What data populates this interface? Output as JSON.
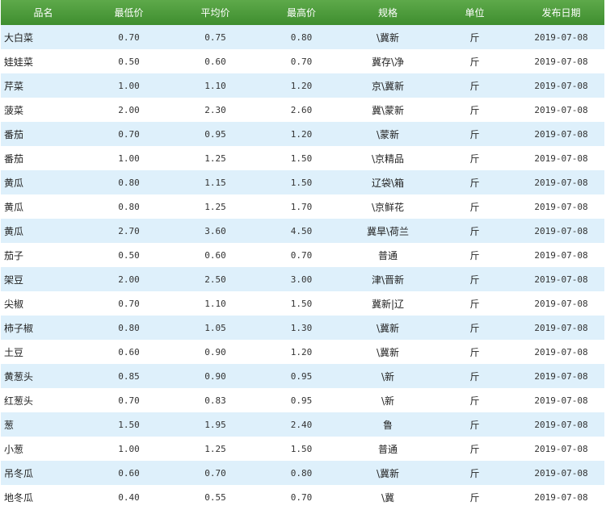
{
  "table": {
    "headers": [
      "品名",
      "最低价",
      "平均价",
      "最高价",
      "规格",
      "单位",
      "发布日期"
    ],
    "rows": [
      [
        "大白菜",
        "0.70",
        "0.75",
        "0.80",
        "\\冀新",
        "斤",
        "2019-07-08"
      ],
      [
        "娃娃菜",
        "0.50",
        "0.60",
        "0.70",
        "冀存\\净",
        "斤",
        "2019-07-08"
      ],
      [
        "芹菜",
        "1.00",
        "1.10",
        "1.20",
        "京\\冀新",
        "斤",
        "2019-07-08"
      ],
      [
        "菠菜",
        "2.00",
        "2.30",
        "2.60",
        "冀\\蒙新",
        "斤",
        "2019-07-08"
      ],
      [
        "番茄",
        "0.70",
        "0.95",
        "1.20",
        "\\蒙新",
        "斤",
        "2019-07-08"
      ],
      [
        "番茄",
        "1.00",
        "1.25",
        "1.50",
        "\\京精品",
        "斤",
        "2019-07-08"
      ],
      [
        "黄瓜",
        "0.80",
        "1.15",
        "1.50",
        "辽袋\\箱",
        "斤",
        "2019-07-08"
      ],
      [
        "黄瓜",
        "0.80",
        "1.25",
        "1.70",
        "\\京鲜花",
        "斤",
        "2019-07-08"
      ],
      [
        "黄瓜",
        "2.70",
        "3.60",
        "4.50",
        "冀旱\\荷兰",
        "斤",
        "2019-07-08"
      ],
      [
        "茄子",
        "0.50",
        "0.60",
        "0.70",
        "普通",
        "斤",
        "2019-07-08"
      ],
      [
        "架豆",
        "2.00",
        "2.50",
        "3.00",
        "津\\晋新",
        "斤",
        "2019-07-08"
      ],
      [
        "尖椒",
        "0.70",
        "1.10",
        "1.50",
        "冀新|辽",
        "斤",
        "2019-07-08"
      ],
      [
        "柿子椒",
        "0.80",
        "1.05",
        "1.30",
        "\\冀新",
        "斤",
        "2019-07-08"
      ],
      [
        "土豆",
        "0.60",
        "0.90",
        "1.20",
        "\\冀新",
        "斤",
        "2019-07-08"
      ],
      [
        "黄葱头",
        "0.85",
        "0.90",
        "0.95",
        "\\新",
        "斤",
        "2019-07-08"
      ],
      [
        "红葱头",
        "0.70",
        "0.83",
        "0.95",
        "\\新",
        "斤",
        "2019-07-08"
      ],
      [
        "葱",
        "1.50",
        "1.95",
        "2.40",
        "鲁",
        "斤",
        "2019-07-08"
      ],
      [
        "小葱",
        "1.00",
        "1.25",
        "1.50",
        "普通",
        "斤",
        "2019-07-08"
      ],
      [
        "吊冬瓜",
        "0.60",
        "0.70",
        "0.80",
        "\\冀新",
        "斤",
        "2019-07-08"
      ],
      [
        "地冬瓜",
        "0.40",
        "0.55",
        "0.70",
        "\\冀",
        "斤",
        "2019-07-08"
      ]
    ]
  }
}
